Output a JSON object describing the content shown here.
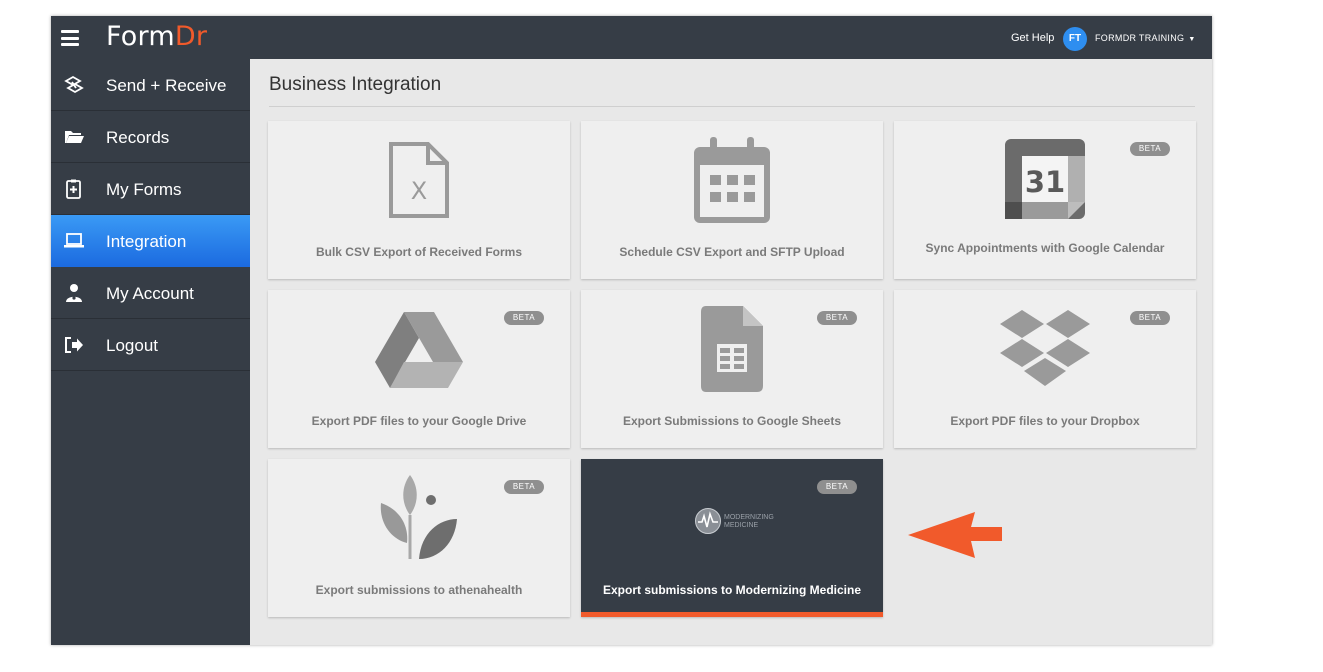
{
  "header": {
    "logo_part1": "Form",
    "logo_part2": "Dr",
    "get_help": "Get Help",
    "avatar_initials": "FT",
    "user_name": "FORMDR TRAINING",
    "caret": "▼"
  },
  "sidebar": {
    "items": [
      {
        "label": "Send + Receive",
        "icon": "send-receive-icon"
      },
      {
        "label": "Records",
        "icon": "folder-icon"
      },
      {
        "label": "My Forms",
        "icon": "clipboard-icon"
      },
      {
        "label": "Integration",
        "icon": "laptop-icon",
        "active": true
      },
      {
        "label": "My Account",
        "icon": "user-icon"
      },
      {
        "label": "Logout",
        "icon": "logout-icon"
      }
    ]
  },
  "main": {
    "title": "Business Integration",
    "cards": [
      {
        "label": "Bulk CSV Export of Received Forms",
        "icon": "csv-file-icon",
        "badge": ""
      },
      {
        "label": "Schedule CSV Export and SFTP Upload",
        "icon": "calendar-icon",
        "badge": ""
      },
      {
        "label": "Sync Appointments with Google Calendar",
        "icon": "google-calendar-icon",
        "badge": "BETA",
        "icon_text": "31"
      },
      {
        "label": "Export PDF files to your Google Drive",
        "icon": "google-drive-icon",
        "badge": "BETA"
      },
      {
        "label": "Export Submissions to Google Sheets",
        "icon": "google-sheets-icon",
        "badge": "BETA"
      },
      {
        "label": "Export PDF files to your Dropbox",
        "icon": "dropbox-icon",
        "badge": "BETA"
      },
      {
        "label": "Export submissions to athenahealth",
        "icon": "athenahealth-icon",
        "badge": "BETA"
      },
      {
        "label": "Export submissions to Modernizing Medicine",
        "icon": "modernizing-medicine-logo",
        "badge": "BETA",
        "logo_line1": "MODERNIZING",
        "logo_line2": "MEDICINE"
      }
    ]
  },
  "colors": {
    "header_bg": "#363d46",
    "accent": "#f15a2b",
    "active_nav": "#2a82ee",
    "card_bg": "#efefef",
    "icon_gray": "#9a9a9a"
  }
}
